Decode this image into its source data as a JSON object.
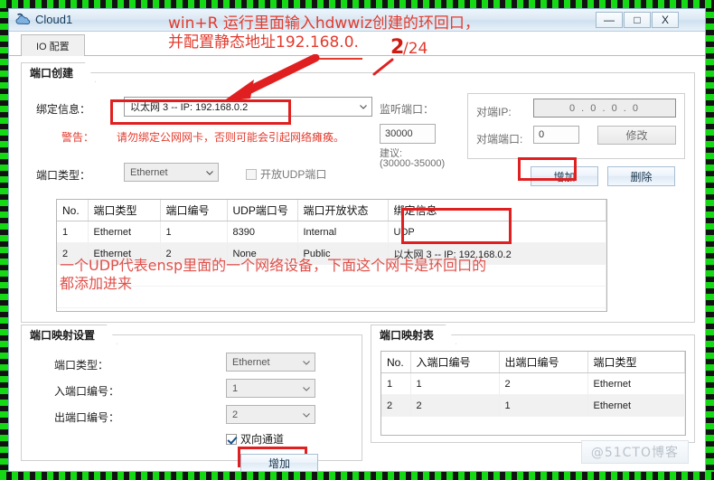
{
  "window": {
    "title": "Cloud1",
    "icon": "cloud-icon",
    "buttons": {
      "minimize": "—",
      "maximize": "□",
      "close": "X"
    }
  },
  "tabs": [
    {
      "label": "IO 配置"
    }
  ],
  "annotations": {
    "top_line1": "win+R 运行里面输入hdwwiz创建的环回口，",
    "top_line2": "并配置静态地址192.168.0.",
    "top_ip_digit": "2",
    "top_line2_tail": "/24",
    "middle_line1": "一个UDP代表ensp里面的一个网络设备，下面这个网卡是环回口的",
    "middle_line2": "都添加进来"
  },
  "port_create": {
    "title": "端口创建",
    "binding_label": "绑定信息：",
    "binding_value": "以太网 3 -- IP: 192.168.0.2",
    "warning_label": "警告：",
    "warning_text": "请勿绑定公网网卡，否则可能会引起网络瘫痪。",
    "port_type_label": "端口类型：",
    "port_type_value": "Ethernet",
    "udp_checkbox_label": "开放UDP端口",
    "udp_checkbox_checked": false,
    "listen_port_label": "监听端口：",
    "listen_port_value": "30000",
    "suggest_label": "建议:",
    "suggest_range": "(30000-35000)",
    "peer_ip_label": "对端IP:",
    "peer_ip_value": "0 . 0 . 0 . 0",
    "peer_port_label": "对端端口:",
    "peer_port_value": "0",
    "modify_button": "修改",
    "add_button": "增加",
    "delete_button": "删除"
  },
  "port_table": {
    "columns": [
      "No.",
      "端口类型",
      "端口编号",
      "UDP端口号",
      "端口开放状态",
      "绑定信息"
    ],
    "rows": [
      {
        "no": "1",
        "type": "Ethernet",
        "number": "1",
        "udp_port": "8390",
        "status": "Internal",
        "binding": "UDP"
      },
      {
        "no": "2",
        "type": "Ethernet",
        "number": "2",
        "udp_port": "None",
        "status": "Public",
        "binding": "以太网 3 -- IP: 192.168.0.2"
      }
    ]
  },
  "map_settings": {
    "title": "端口映射设置",
    "port_type_label": "端口类型：",
    "port_type_value": "Ethernet",
    "in_port_label": "入端口编号：",
    "in_port_value": "1",
    "out_port_label": "出端口编号：",
    "out_port_value": "2",
    "bidirectional_label": "双向通道",
    "bidirectional_checked": true,
    "add_button": "增加"
  },
  "map_table": {
    "title": "端口映射表",
    "columns": [
      "No.",
      "入端口编号",
      "出端口编号",
      "端口类型"
    ],
    "rows": [
      {
        "no": "1",
        "in_port": "1",
        "out_port": "2",
        "type": "Ethernet"
      },
      {
        "no": "2",
        "in_port": "2",
        "out_port": "1",
        "type": "Ethernet"
      }
    ]
  },
  "watermark": "@51CTO博客",
  "colors": {
    "annotation_red": "#e23b2e",
    "highlight_box": "#e02020",
    "title_text": "#123a5e",
    "selection_green": "#16d916"
  }
}
